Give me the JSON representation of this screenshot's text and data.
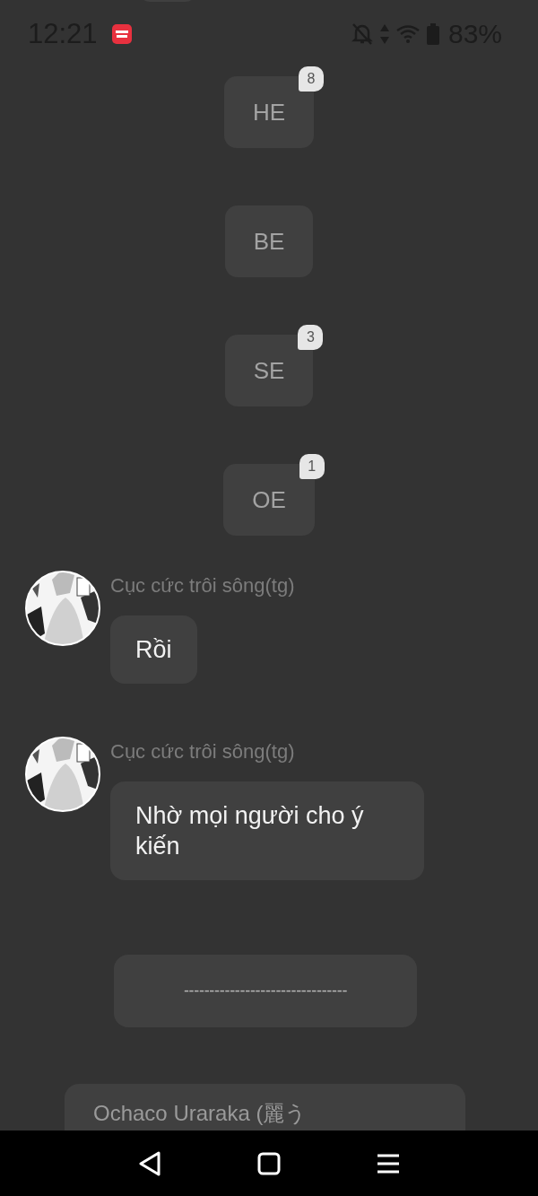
{
  "status_bar": {
    "time": "12:21",
    "battery": "83%"
  },
  "system_messages": [
    {
      "text": "HE",
      "badge": "8"
    },
    {
      "text": "BE"
    },
    {
      "text": "SE",
      "badge": "3"
    },
    {
      "text": "OE",
      "badge": "1"
    }
  ],
  "messages": [
    {
      "sender": "Cục cức trôi sông(tg)",
      "text": "Rồi"
    },
    {
      "sender": "Cục cức trôi sông(tg)",
      "text": "Nhờ mọi người cho ý kiến"
    }
  ],
  "divider_message": {
    "text": "--------------------------------"
  },
  "last_message": {
    "text": "Ochaco Uraraka (麗う"
  }
}
